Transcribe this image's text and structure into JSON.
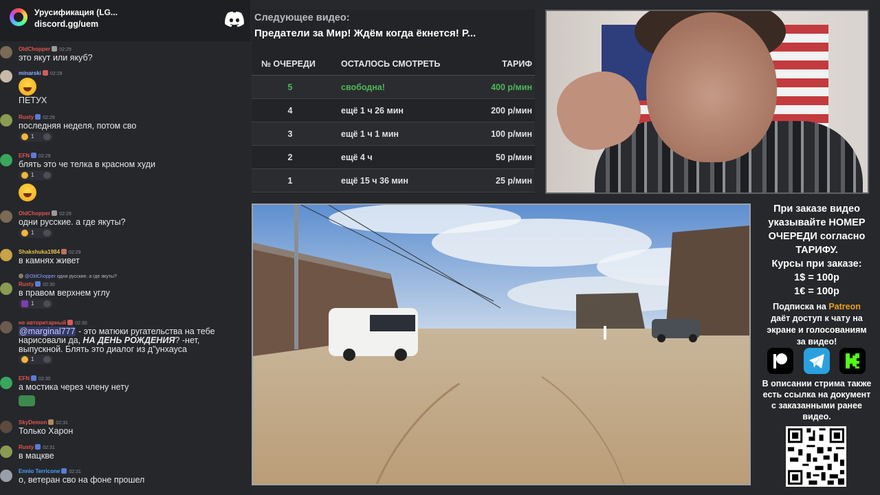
{
  "chat": {
    "server_name": "Урусификация (LG...",
    "invite": "discord.gg/uem",
    "messages": [
      {
        "author": "OldChopper",
        "time": "02:29",
        "color": "#e0554d",
        "text": "это якут или якуб?"
      },
      {
        "author": "minarski",
        "time": "02:29",
        "color": "#8fb0ff",
        "text": "ПЕТУХ"
      },
      {
        "author": "Rusty",
        "time": "02:29",
        "color": "#e0554d",
        "text": "последняя неделя, потом сво",
        "reaction_count": "1"
      },
      {
        "author": "EFN",
        "time": "02:29",
        "color": "#e0554d",
        "text": "блять это че телка в красном худи",
        "reaction_count": "1"
      },
      {
        "author": "OldChopper",
        "time": "02:29",
        "color": "#e0554d",
        "text": "одни русские. а где якуты?",
        "reaction_count": "1"
      },
      {
        "author": "Shakshuka1984",
        "time": "02:29",
        "color": "#e8c24a",
        "text": "в камнях живет"
      },
      {
        "author": "Rusty",
        "time": "02:30",
        "color": "#e0554d",
        "text": "в правом верхнем углу",
        "reaction_count": "1",
        "reply_author": "@OldChopper",
        "reply_text": "одни русские. а где якуты?"
      },
      {
        "author": "не авторитарный",
        "time": "02:30",
        "color": "#e0554d",
        "mention": "@marginal777",
        "text_a": " - это матюки ругательства на тебе",
        "text_b": "нарисовали да, ",
        "text_b_bold": "НА ДЕНЬ РОЖДЕНИЯ",
        "text_b_end": "? -нет,",
        "text_c": "выпускной. Блять это диалог из д\"унхауса",
        "reaction_count": "1"
      },
      {
        "author": "EFN",
        "time": "02:30",
        "color": "#e0554d",
        "text": "а мостика через члену нету"
      },
      {
        "author": "SkyDemon",
        "time": "02:31",
        "color": "#e0554d",
        "text": "Только Харон"
      },
      {
        "author": "Rusty",
        "time": "02:31",
        "color": "#e0554d",
        "text": "в мацкве"
      },
      {
        "author": "Ennio Terricone",
        "time": "02:31",
        "color": "#4aa3ff",
        "text": "о, ветеран сво на фоне прошел"
      }
    ]
  },
  "queue": {
    "label": "Следующее видео:",
    "title": "Предатели за Мир! Ждём когда ёкнется! Р...",
    "headers": [
      "№ ОЧЕРЕДИ",
      "ОСТАЛОСЬ СМОТРЕТЬ",
      "ТАРИФ"
    ],
    "rows": [
      {
        "num": "5",
        "left": "свободна!",
        "rate": "400 р/мин"
      },
      {
        "num": "4",
        "left": "ещё 1 ч 26 мин",
        "rate": "200 р/мин"
      },
      {
        "num": "3",
        "left": "ещё 1 ч 1 мин",
        "rate": "100 р/мин"
      },
      {
        "num": "2",
        "left": "ещё 4 ч",
        "rate": "50 р/мин"
      },
      {
        "num": "1",
        "left": "ещё 15 ч 36 мин",
        "rate": "25 р/мин"
      }
    ]
  },
  "info": {
    "order_line1": "При заказе видео",
    "order_line2": "указывайте НОМЕР",
    "order_line3": "ОЧЕРЕДИ согласно",
    "order_line4": "ТАРИФУ.",
    "rates_title": "Курсы при заказе:",
    "usd": "1$ = 100р",
    "eur": "1€ = 100р",
    "sub_prefix": "Подписка на ",
    "sub_patreon": "Patreon",
    "sub_line2": "даёт доступ к чату на",
    "sub_line3": "экране и голосованиям",
    "sub_line4": "за видео!",
    "desc_line1": "В описании стрима также",
    "desc_line2": "есть ссылка на документ",
    "desc_line3": "с заказанными ранее",
    "desc_line4": "видео."
  }
}
